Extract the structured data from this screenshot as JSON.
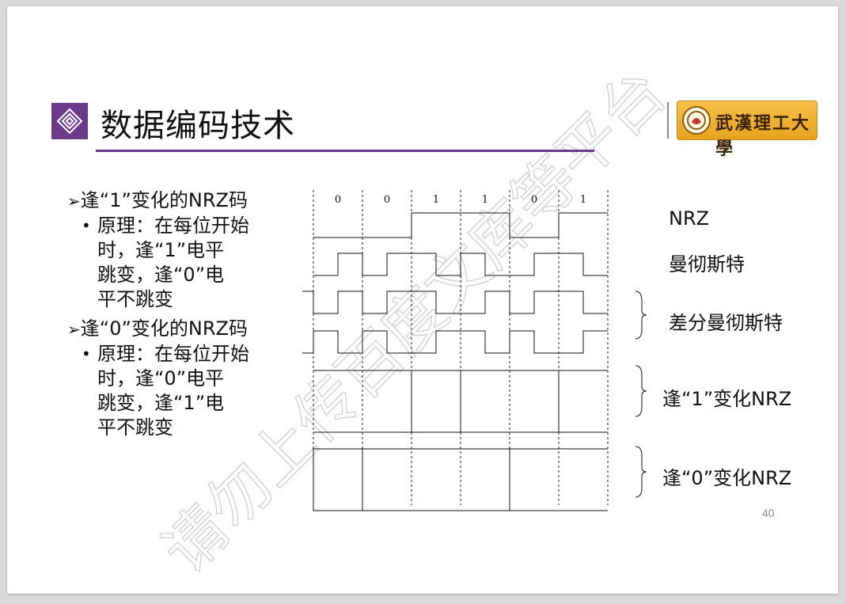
{
  "slide": {
    "title": "数据编码技术",
    "logo_text": "武漢理工大學",
    "page_number": "40",
    "watermark": "请勿上传百度文库等平台"
  },
  "bullets": [
    {
      "level": 1,
      "marker": "➢",
      "text": "逢“1”变化的NRZ码"
    },
    {
      "level": 2,
      "marker": "•",
      "lines": [
        "原理：在每位开始",
        "时，逢“1”电平",
        "跳变，逢“0”电",
        "平不跳变"
      ]
    },
    {
      "level": 1,
      "marker": "➢",
      "text": "逢“0”变化的NRZ码"
    },
    {
      "level": 2,
      "marker": "•",
      "lines": [
        "原理：在每位开始",
        "时，逢“0”电平",
        "跳变，逢“1”电",
        "平不跳变"
      ]
    }
  ],
  "diagram": {
    "bits": [
      "0",
      "0",
      "1",
      "1",
      "0",
      "1"
    ],
    "labels": {
      "nrz": "NRZ",
      "manchester": "曼彻斯特",
      "diff_manchester": "差分曼彻斯特",
      "nrz_change_on_1": "逢“1”变化NRZ",
      "nrz_change_on_0": "逢“0”变化NRZ"
    }
  },
  "colors": {
    "accent": "#6b3a8a",
    "logo_bg": "#e6a21f"
  }
}
